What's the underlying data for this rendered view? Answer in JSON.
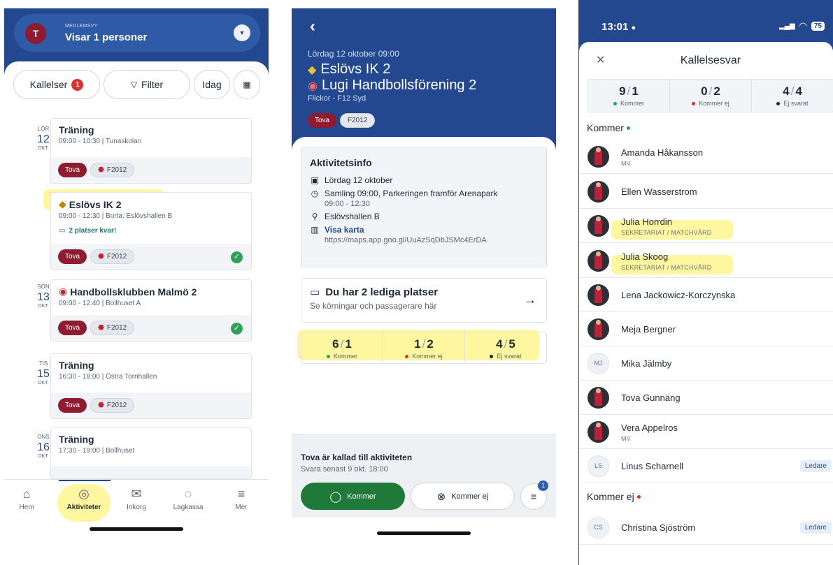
{
  "colors": {
    "brand_blue": "#23488f",
    "tag_maroon": "#8e1b2f",
    "green": "#2ea05a",
    "red": "#d9342b",
    "highlight": "#fff050"
  },
  "screen1": {
    "member_view": {
      "avatar_initial": "T",
      "small_label": "MEDLEMSVY",
      "title": "Visar 1 personer"
    },
    "toolbar": {
      "kallelser_label": "Kallelser",
      "kallelser_count": "1",
      "filter_label": "Filter",
      "idag_label": "Idag",
      "calendar_icon": "calendar-add-icon"
    },
    "days": [
      {
        "weekday": "LÖR",
        "day": "12",
        "month": "OKT."
      },
      {
        "weekday": "SÖN",
        "day": "13",
        "month": "OKT."
      },
      {
        "weekday": "TIS",
        "day": "15",
        "month": "OKT."
      },
      {
        "weekday": "ONS",
        "day": "16",
        "month": "OKT."
      }
    ],
    "activities": [
      {
        "title": "Träning",
        "time": "09:00 - 10:30",
        "place": "Tunaskolan",
        "tag": "Tova",
        "team": "F2012"
      },
      {
        "title": "Eslövs IK 2",
        "time": "09:00 - 12:30",
        "place": "Borta: Eslövshallen B",
        "car": "2 platser kvar!",
        "tag": "Tova",
        "team": "F2012"
      },
      {
        "title": "Handbollsklubben Malmö 2",
        "time": "09:00 - 12:40",
        "place": "Bollhuset A",
        "tag": "Tova",
        "team": "F2012"
      },
      {
        "title": "Träning",
        "time": "16:30 - 18:00",
        "place": "Östra Tornhallen",
        "tag": "Tova",
        "team": "F2012"
      },
      {
        "title": "Träning",
        "time": "17:30 - 19:00",
        "place": "Bollhuset"
      }
    ],
    "tabs": [
      {
        "label": "Hem",
        "icon": "home-icon"
      },
      {
        "label": "Aktiviteter",
        "icon": "check-circle-icon"
      },
      {
        "label": "Inkorg",
        "icon": "mail-icon"
      },
      {
        "label": "Lagkassa",
        "icon": "piggy-bank-icon"
      },
      {
        "label": "Mer",
        "icon": "menu-icon"
      }
    ]
  },
  "screen2": {
    "date": "Lördag 12 oktober 09:00",
    "home_team": "Eslövs IK 2",
    "away_team": "Lugi Handbollsförening 2",
    "league": "Flickor - F12 Syd",
    "tags": [
      "Tova",
      "F2012"
    ],
    "info": {
      "title": "Aktivitetsinfo",
      "date": "Lördag 12 oktober",
      "gathering": "Samling 09:00, Parkeringen framför Arenapark",
      "time": "09:00 - 12:30",
      "venue": "Eslövshallen B",
      "map_label": "Visa karta",
      "map_url": "https://maps.app.goo.gl/UuAzSqDbJSMc4ErDA"
    },
    "seats": {
      "title": "Du har 2 lediga platser",
      "subtitle": "Se körningar och passagerare här"
    },
    "stats": [
      {
        "a": "6",
        "b": "1",
        "label": "Kommer"
      },
      {
        "a": "1",
        "b": "2",
        "label": "Kommer ej"
      },
      {
        "a": "4",
        "b": "5",
        "label": "Ej svarat"
      }
    ],
    "footer": {
      "title": "Tova är kallad till aktiviteten",
      "subtitle": "Svara senast 9 okt. 18:00",
      "yes_label": "Kommer",
      "no_label": "Kommer ej",
      "note_count": "1"
    }
  },
  "screen3": {
    "status": {
      "time": "13:01",
      "battery": "75"
    },
    "title": "Kallelsesvar",
    "stats": [
      {
        "a": "9",
        "b": "1",
        "label": "Kommer"
      },
      {
        "a": "0",
        "b": "2",
        "label": "Kommer ej"
      },
      {
        "a": "4",
        "b": "4",
        "label": "Ej svarat"
      }
    ],
    "section_coming": "Kommer",
    "section_not_coming": "Kommer ej",
    "leader_label": "Ledare",
    "people": [
      {
        "name": "Amanda Håkansson",
        "role": "MV"
      },
      {
        "name": "Ellen Wasserstrom",
        "role": ""
      },
      {
        "name": "Julia Horrdin",
        "role": "SEKRETARIAT / MATCHVÄRD"
      },
      {
        "name": "Julia Skoog",
        "role": "SEKRETARIAT / MATCHVÄRD"
      },
      {
        "name": "Lena Jackowicz-Korczynska",
        "role": ""
      },
      {
        "name": "Meja Bergner",
        "role": ""
      },
      {
        "name": "Mika Jälmby",
        "role": "",
        "initials": "MJ"
      },
      {
        "name": "Tova Gunnäng",
        "role": ""
      },
      {
        "name": "Vera Appelros",
        "role": "MV"
      },
      {
        "name": "Linus Scharnell",
        "role": "",
        "initials": "LS"
      }
    ],
    "not_coming": [
      {
        "name": "Christina Sjöström",
        "initials": "CS"
      }
    ]
  }
}
